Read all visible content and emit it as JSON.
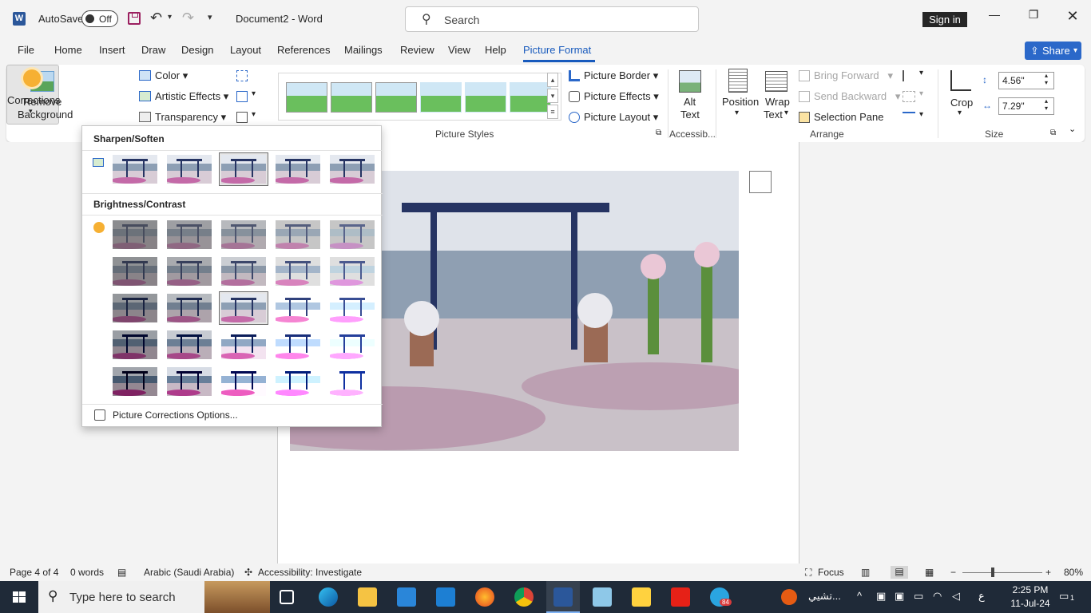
{
  "titlebar": {
    "autosave_label": "AutoSave",
    "autosave_state": "Off",
    "doc_title": "Document2  -  Word",
    "search_placeholder": "Search",
    "signin_label": "Sign in"
  },
  "tabs": [
    "File",
    "Home",
    "Insert",
    "Draw",
    "Design",
    "Layout",
    "References",
    "Mailings",
    "Review",
    "View",
    "Help",
    "Picture Format"
  ],
  "active_tab": "Picture Format",
  "share_label": "Share",
  "ribbon": {
    "remove_bg": [
      "Remove",
      "Background"
    ],
    "corrections": "Corrections",
    "color": "Color",
    "artistic_effects": "Artistic Effects",
    "transparency": "Transparency",
    "picture_styles_label": "Picture Styles",
    "picture_border": "Picture Border",
    "picture_effects": "Picture Effects",
    "picture_layout": "Picture Layout",
    "alt_text": [
      "Alt",
      "Text"
    ],
    "accessibility_label": "Accessib...",
    "position": "Position",
    "wrap_text": [
      "Wrap",
      "Text"
    ],
    "bring_forward": "Bring Forward",
    "send_backward": "Send Backward",
    "selection_pane": "Selection Pane",
    "arrange_label": "Arrange",
    "crop": "Crop",
    "height": "4.56\"",
    "width": "7.29\"",
    "size_label": "Size"
  },
  "dropdown": {
    "sharpen_heading": "Sharpen/Soften",
    "brightness_heading": "Brightness/Contrast",
    "options_link": "Picture Corrections Options...",
    "sharpen_selected_index": 2,
    "brightness_selected": [
      2,
      2
    ]
  },
  "statusbar": {
    "page": "Page 4 of 4",
    "words": "0 words",
    "language": "Arabic (Saudi Arabia)",
    "accessibility": "Accessibility: Investigate",
    "focus": "Focus",
    "zoom": "80%"
  },
  "taskbar": {
    "search_placeholder": "Type here to search",
    "arabic_label": "تشيي...",
    "lang_indicator": "ع",
    "time": "2:25 PM",
    "date": "11-Jul-24",
    "telegram_badge": "84",
    "notification_count": "1"
  }
}
